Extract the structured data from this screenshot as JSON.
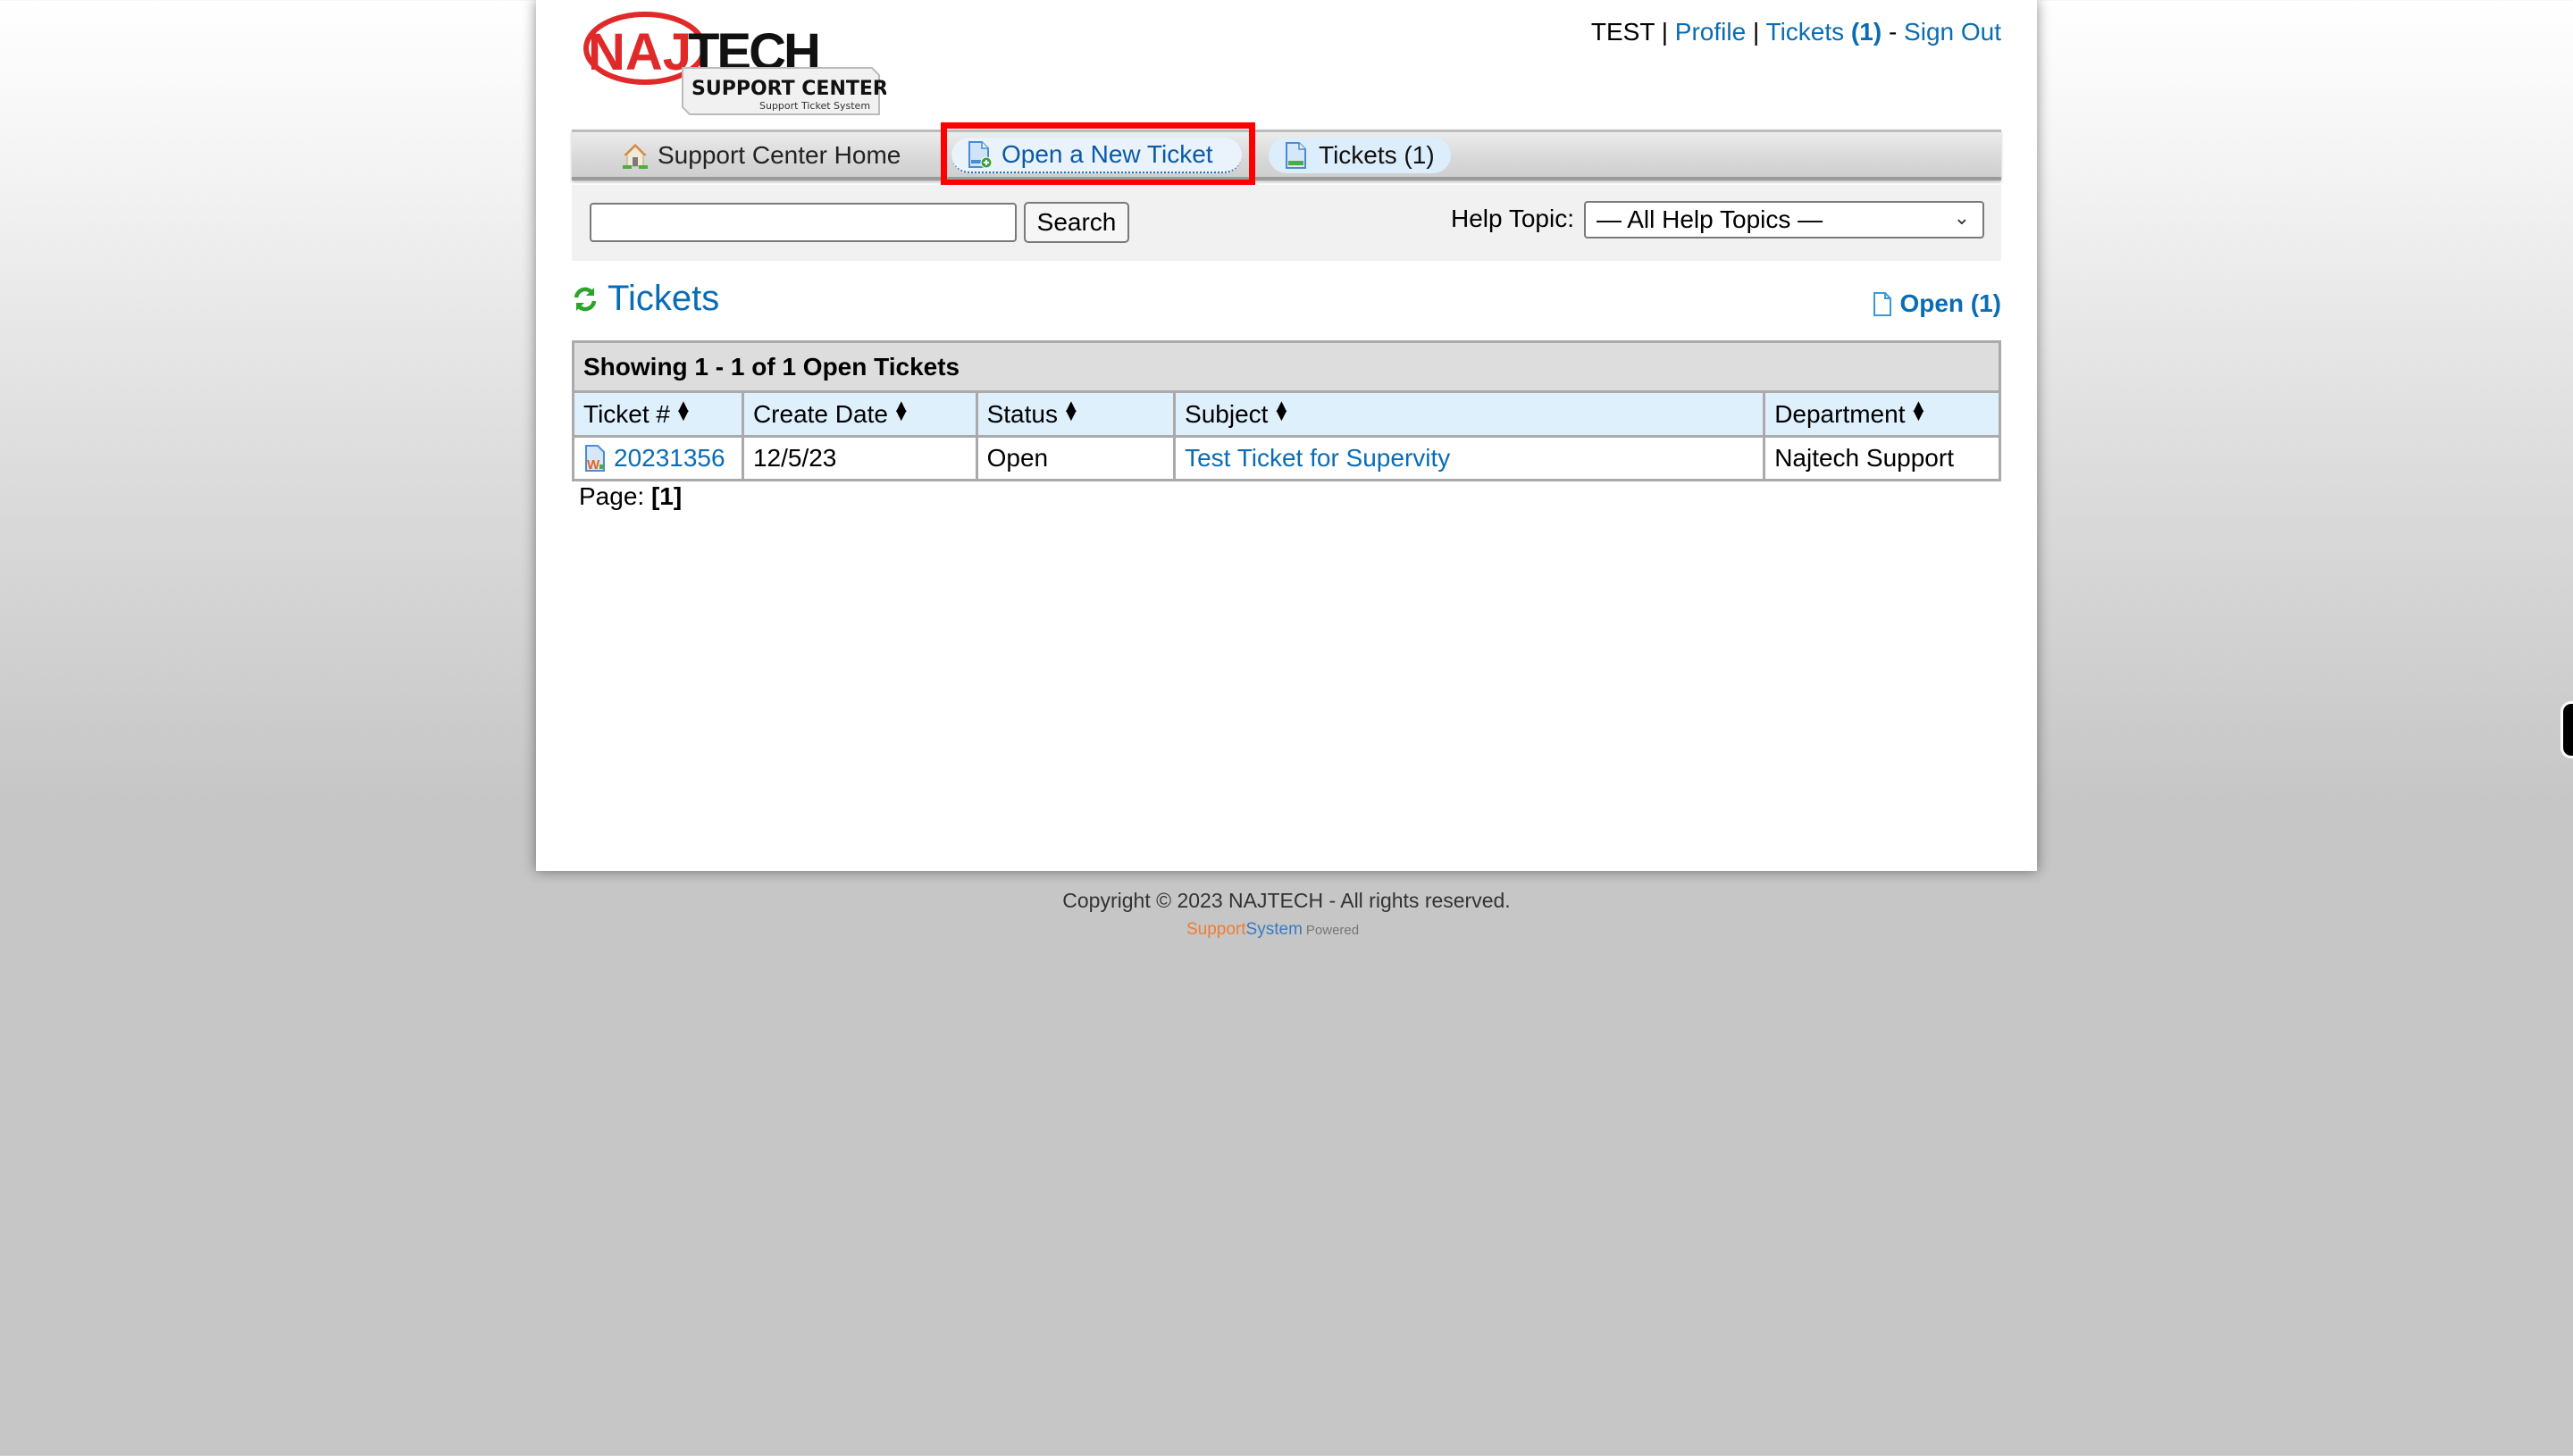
{
  "logo": {
    "brand_part1": "NAJ",
    "brand_part2": "TECH",
    "subtitle": "SUPPORT CENTER",
    "tagline": "Support Ticket System"
  },
  "user_links": {
    "username": "TEST",
    "separator": "|",
    "profile": "Profile",
    "tickets": "Tickets",
    "tickets_count": "(1)",
    "dash": "-",
    "sign_out": "Sign Out"
  },
  "nav": {
    "items": [
      {
        "label": "Support Center Home",
        "icon": "home-icon"
      },
      {
        "label": "Open a New Ticket",
        "icon": "new-ticket-icon",
        "highlighted": true
      },
      {
        "label": "Tickets (1)",
        "icon": "tickets-icon",
        "active": true
      }
    ]
  },
  "search": {
    "value": "",
    "placeholder": "",
    "button_label": "Search",
    "help_topic_label": "Help Topic:",
    "help_topic_selected": "— All Help Topics —"
  },
  "tickets_section": {
    "title": "Tickets",
    "filter_label": "Open (1)"
  },
  "table": {
    "caption": "Showing 1 - 1 of 1 Open Tickets",
    "columns": [
      "Ticket #",
      "Create Date",
      "Status",
      "Subject",
      "Department"
    ],
    "rows": [
      {
        "ticket": "20231356",
        "create_date": "12/5/23",
        "status": "Open",
        "subject": "Test Ticket for Supervity",
        "department": "Najtech Support"
      }
    ]
  },
  "pager": {
    "label": "Page:",
    "current": "[1]"
  },
  "footer": {
    "copyright": "Copyright © 2023 NAJTECH - All rights reserved.",
    "powered_support": "Support",
    "powered_system": "System",
    "powered_word": "Powered"
  },
  "colors": {
    "link": "#0a6cb4",
    "highlight_box": "#ff0000",
    "logo_red": "#e02a2a"
  }
}
